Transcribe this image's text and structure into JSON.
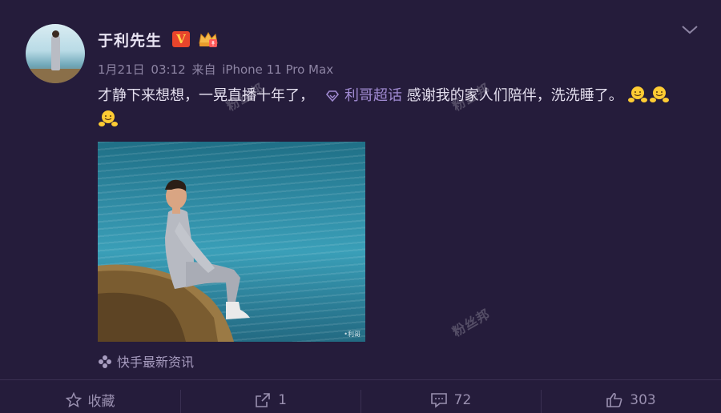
{
  "user": {
    "name": "于利先生",
    "verified_badge": "V",
    "avatar": "avatar-photo"
  },
  "meta": {
    "date": "1月21日",
    "time": "03:12",
    "via_prefix": "来自",
    "device": "iPhone 11 Pro Max"
  },
  "post": {
    "text_before": "才静下来想想，一晃直播十年了，",
    "topic_label": "利哥超话",
    "text_after": "感谢我的家人们陪伴，洗洗睡了。",
    "emoji_icon": "hugging-emoji"
  },
  "image": {
    "corner_mark": "•利哥"
  },
  "source": {
    "label": "快手最新资讯"
  },
  "actions": {
    "favorite_label": "收藏",
    "repost_count": "1",
    "comment_count": "72",
    "like_count": "303"
  },
  "watermarks": [
    "粉丝邦",
    "粉丝邦",
    "粉丝邦"
  ],
  "colors": {
    "background": "#251c3b",
    "topic": "#a08ad1",
    "muted": "#8d84a3",
    "badge_red": "#e8452c",
    "badge_gold": "#ffd54a"
  }
}
